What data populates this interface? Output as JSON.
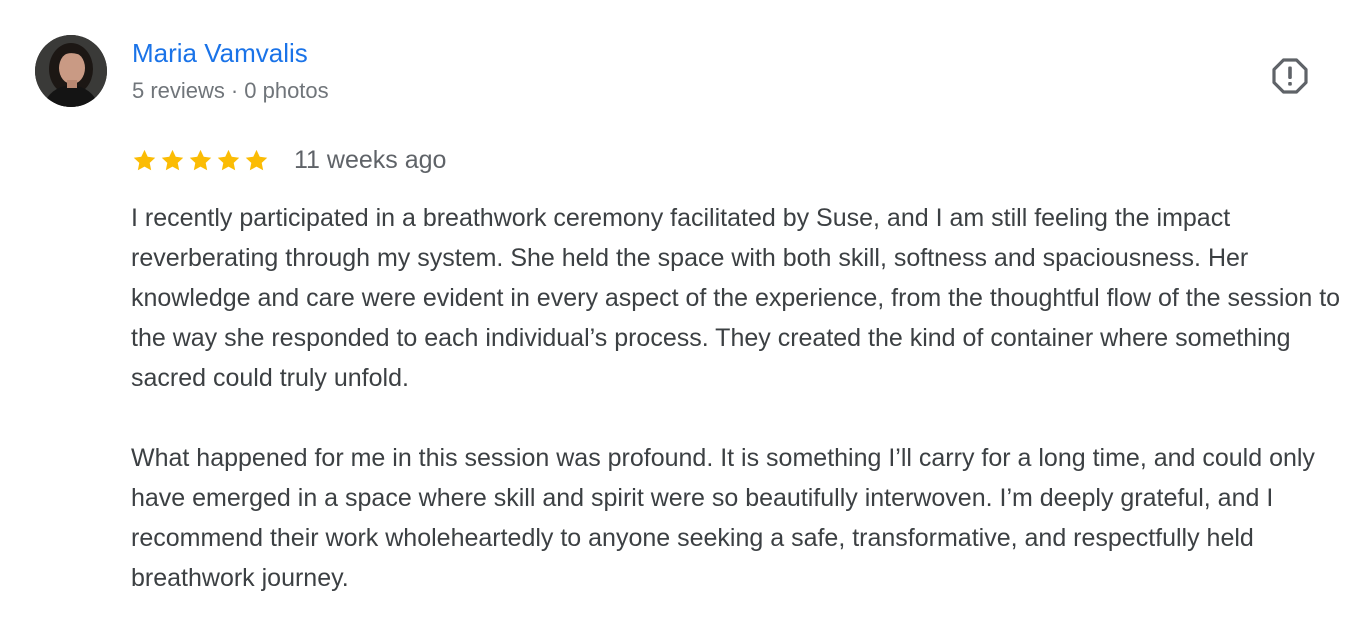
{
  "reviewer": {
    "name": "Maria Vamvalis",
    "reviews_count": "5 reviews",
    "separator": "·",
    "photos_count": "0 photos"
  },
  "review": {
    "rating": 5,
    "rating_max": 5,
    "date": "11 weeks ago",
    "paragraphs": [
      "I recently participated in a breathwork ceremony facilitated by Suse, and I am still feeling the impact reverberating through my system. She held the space with both skill, softness and spaciousness. Her knowledge and care were evident in every aspect of the experience, from the thoughtful flow of the session to the way she responded to each individual’s process. They created the kind of container where something sacred could truly unfold.",
      "What happened for me in this session was profound. It is something I’ll carry for a long time, and could only have emerged in a space where skill and spirit were so beautifully interwoven. I’m deeply grateful, and I recommend their work wholeheartedly to anyone seeking a safe, transformative, and respectfully held breathwork journey."
    ]
  },
  "icons": {
    "flag": "report-flag-icon",
    "star": "star-icon",
    "avatar": "user-avatar"
  },
  "colors": {
    "name_link": "#1a73e8",
    "star": "#fbbc04",
    "meta_text": "#70757a",
    "body_text": "#3c4043",
    "icon": "#5f6368"
  }
}
